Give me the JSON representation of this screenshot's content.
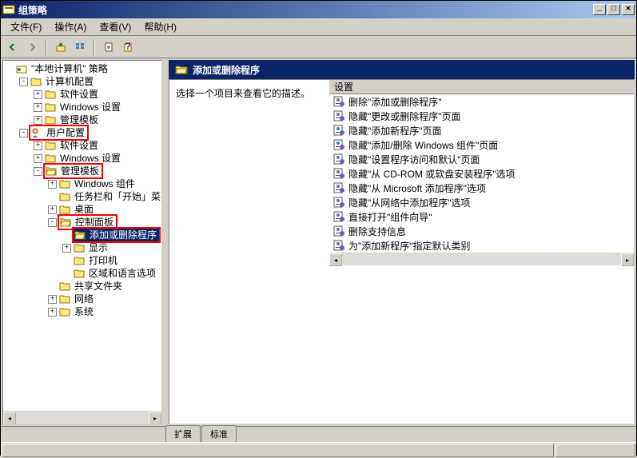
{
  "window": {
    "title": "组策略"
  },
  "menu": {
    "file": "文件(F)",
    "action": "操作(A)",
    "view": "查看(V)",
    "help": "帮助(H)"
  },
  "tree": {
    "root": "\"本地计算机\" 策略",
    "computer_config": "计算机配置",
    "cc_software": "软件设置",
    "cc_windows": "Windows 设置",
    "cc_admin": "管理模板",
    "user_config": "用户配置",
    "uc_software": "软件设置",
    "uc_windows": "Windows 设置",
    "uc_admin": "管理模板",
    "win_components": "Windows 组件",
    "taskbar": "任务栏和「开始」菜",
    "desktop": "桌面",
    "control_panel": "控制面板",
    "add_remove": "添加或删除程序",
    "display": "显示",
    "printer": "打印机",
    "region": "区域和语言选项",
    "shared_folders": "共享文件夹",
    "network": "网络",
    "system": "系统"
  },
  "detail": {
    "header": "添加或删除程序",
    "description": "选择一个项目来查看它的描述。",
    "column_header": "设置"
  },
  "policies": [
    "删除\"添加或删除程序\"",
    "隐藏\"更改或删除程序\"页面",
    "隐藏\"添加新程序\"页面",
    "隐藏\"添加/删除 Windows 组件\"页面",
    "隐藏\"设置程序访问和默认\"页面",
    "隐藏\"从 CD-ROM 或软盘安装程序\"选项",
    "隐藏\"从 Microsoft 添加程序\"选项",
    "隐藏\"从网络中添加程序\"选项",
    "直接打开\"组件向导\"",
    "删除支持信息",
    "为\"添加新程序\"指定默认类别"
  ],
  "tabs": {
    "extended": "扩展",
    "standard": "标准"
  }
}
